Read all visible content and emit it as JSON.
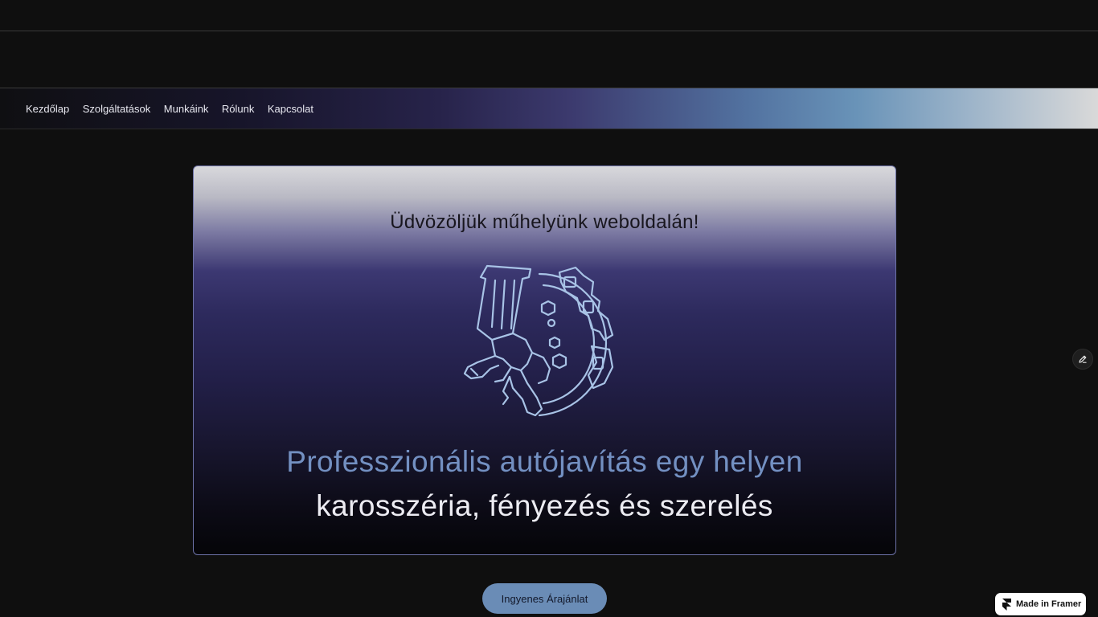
{
  "nav": {
    "items": [
      {
        "label": "Kezdőlap"
      },
      {
        "label": "Szolgáltatások"
      },
      {
        "label": "Munkáink"
      },
      {
        "label": "Rólunk"
      },
      {
        "label": "Kapcsolat"
      }
    ]
  },
  "hero": {
    "title": "Üdvözöljük műhelyünk weboldalán!",
    "logo_icon": "spray-gun-brake-disc-icon",
    "headline": "Professzionális autójavítás egy helyen",
    "subheadline": "karosszéria, fényezés és szerelés"
  },
  "cta": {
    "label": "Ingyenes Árajánlat"
  },
  "edit_button": {
    "icon": "pencil-icon"
  },
  "framer_badge": {
    "icon": "framer-logo-icon",
    "label": "Made in Framer"
  },
  "colors": {
    "background": "#0f0f0f",
    "accent": "#6a8cb6",
    "headline": "#7390c2",
    "logo_stroke": "#a8c3e6"
  }
}
